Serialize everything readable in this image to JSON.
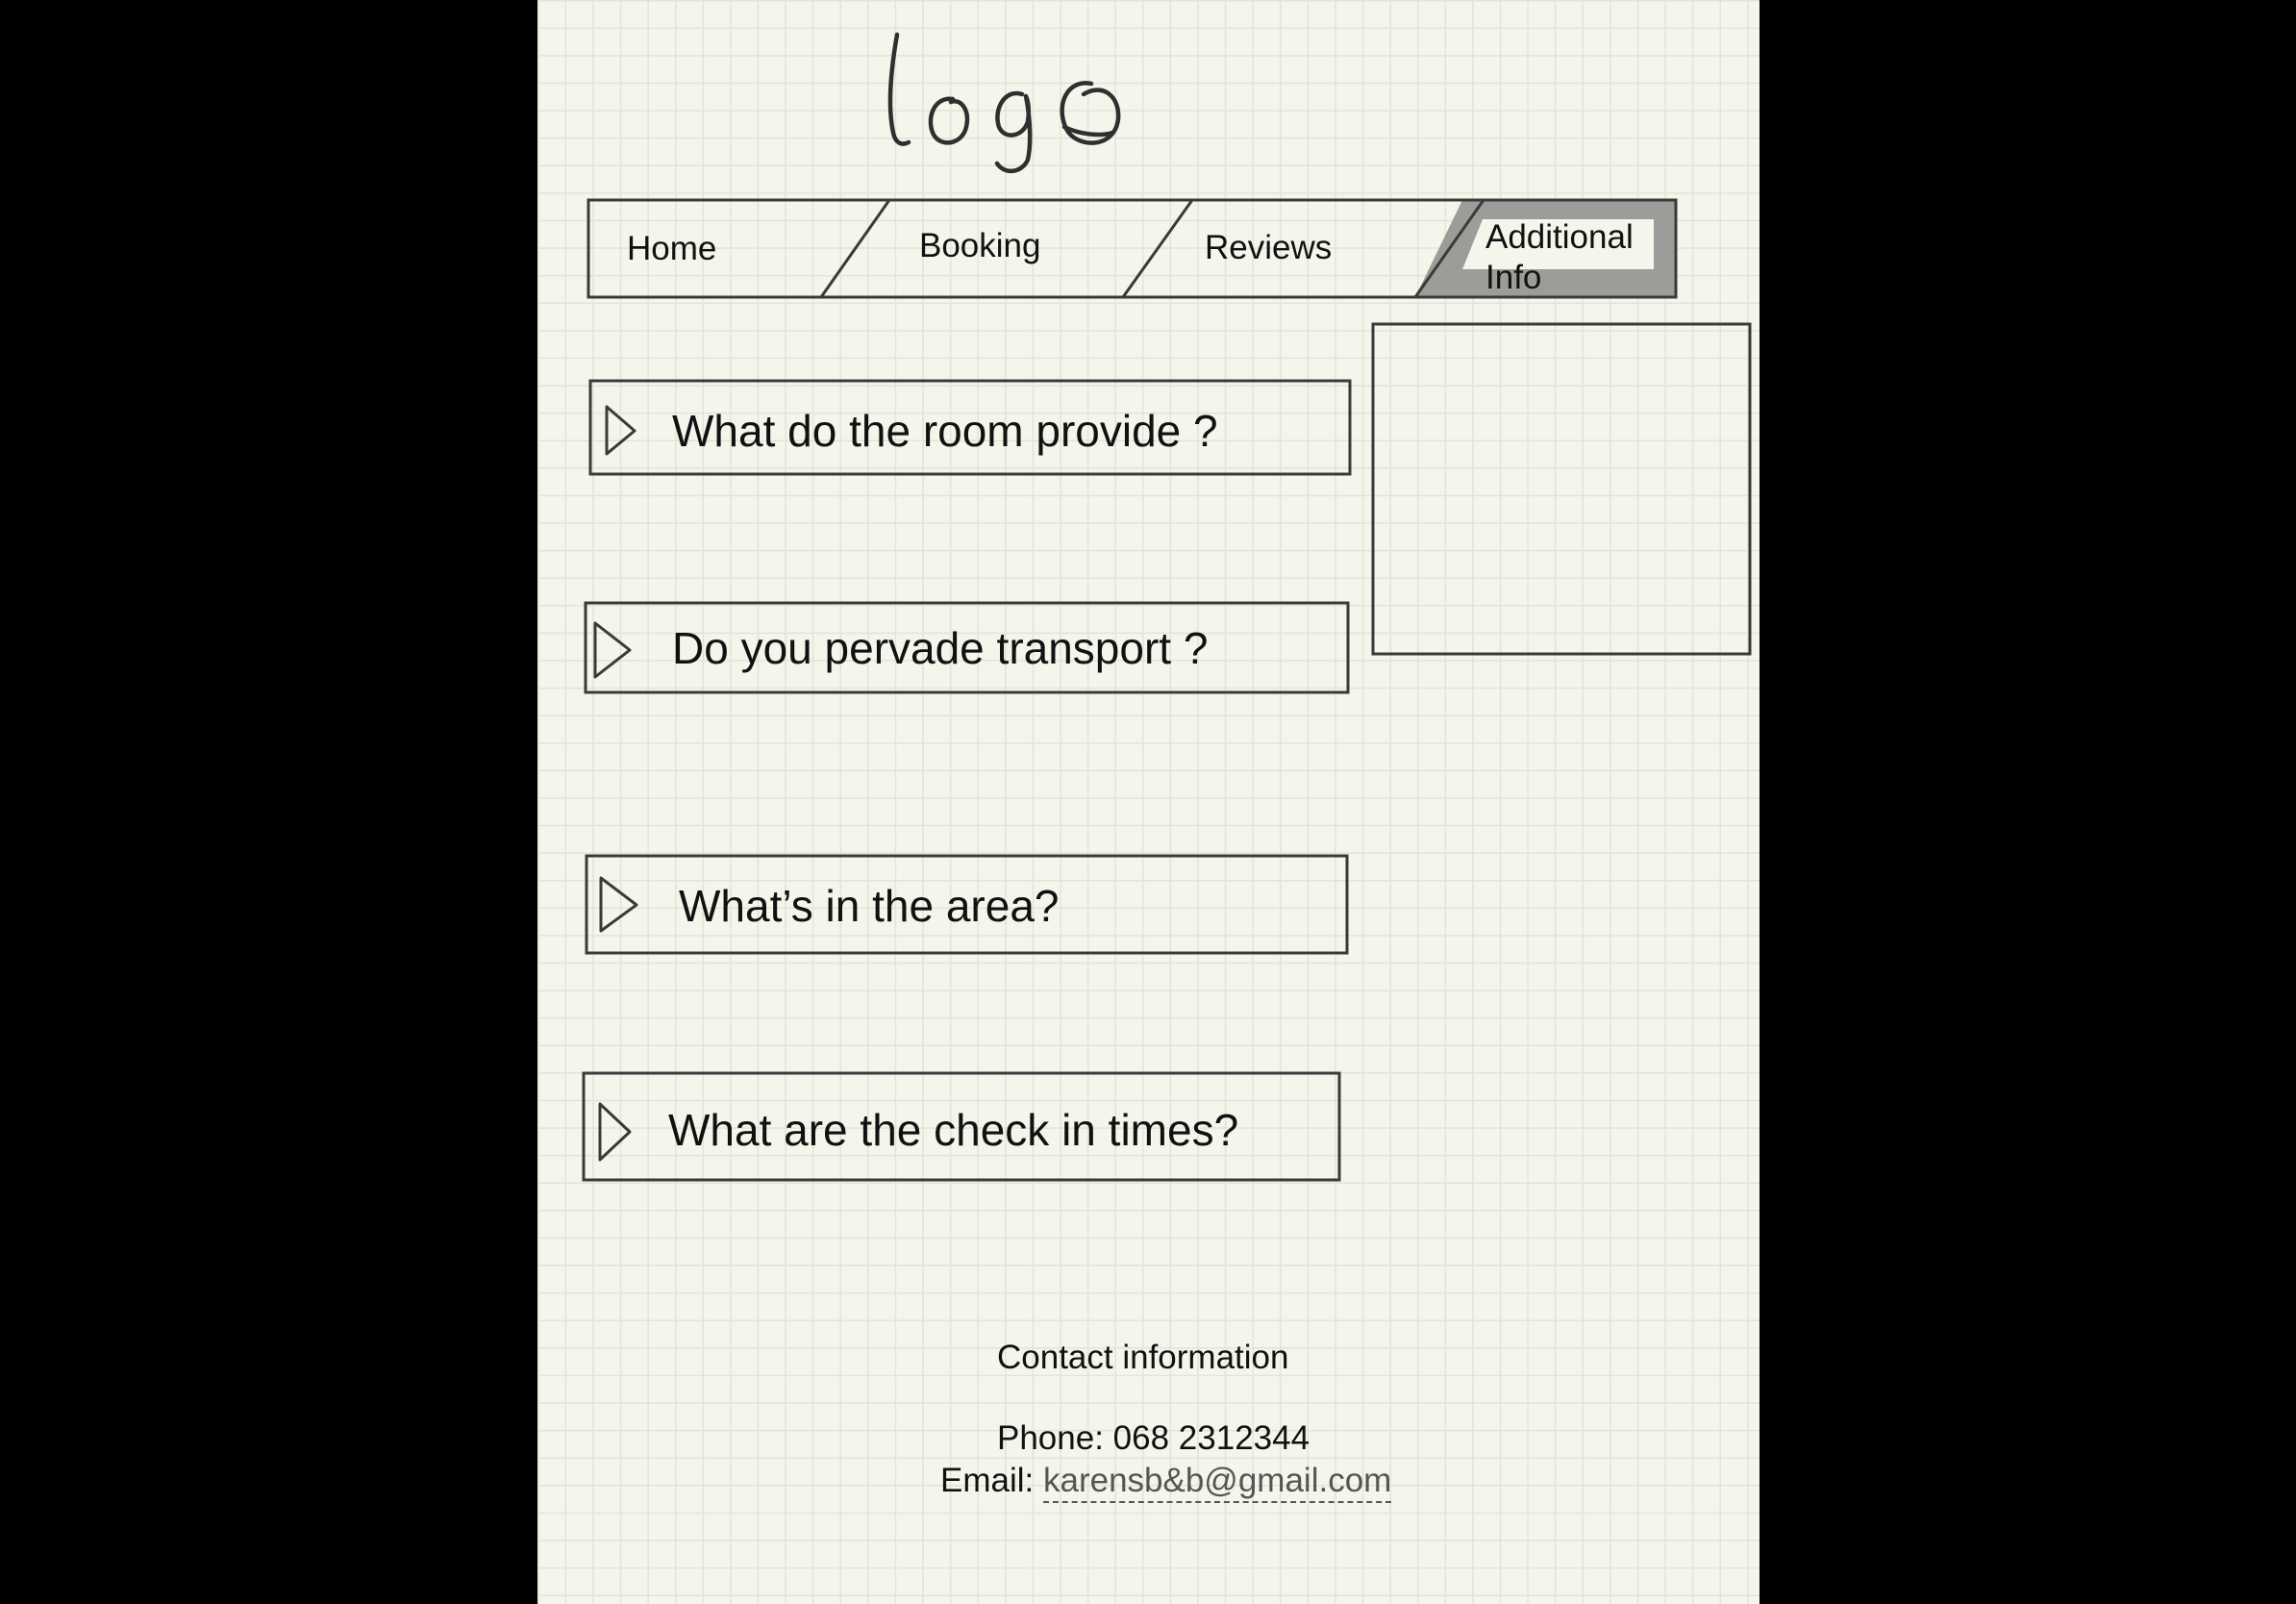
{
  "logo": {
    "text": "logo"
  },
  "nav": {
    "tabs": [
      {
        "label": "Home",
        "active": false
      },
      {
        "label": "Booking",
        "active": false
      },
      {
        "label": "Reviews",
        "active": false
      },
      {
        "label": "Additional Info",
        "line1": "Additional",
        "line2": "Info",
        "active": true
      }
    ]
  },
  "faq": {
    "items": [
      {
        "question": "What do the room provide ?"
      },
      {
        "question": "Do you pervade transport ?"
      },
      {
        "question": "What’s in the area?"
      },
      {
        "question": "What are the check in times?"
      }
    ],
    "expander_icon": "play-triangle-icon"
  },
  "side_box": {
    "content": ""
  },
  "contact": {
    "title": "Contact information",
    "phone_label": "Phone:",
    "phone_value": "068 2312344",
    "email_label": "Email:",
    "email_value": "karensb&b@gmail.com"
  },
  "colors": {
    "page_background": "#000000",
    "paper": "#f5f5ec",
    "grid": "#e3e3d8",
    "ink": "#3a3a3a",
    "active_tab": "#9c9c98"
  }
}
